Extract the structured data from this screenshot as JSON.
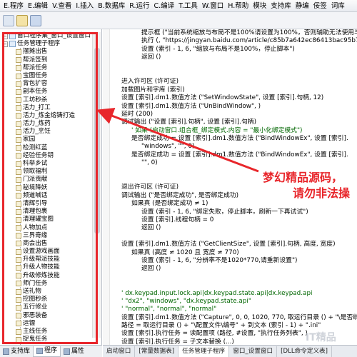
{
  "menubar": {
    "items": [
      "E.程序",
      "E.编辑",
      "V.查看",
      "I.插入",
      "B.数据库",
      "R.运行",
      "C.编译",
      "T.工具",
      "W.窗口",
      "H.帮助",
      "模块",
      "支持库",
      "静编",
      "佞签",
      "词库"
    ]
  },
  "tree": {
    "items": [
      {
        "label": "窗口程序集_窗口_设置窗口",
        "level": 0,
        "kind": "module"
      },
      {
        "label": "任务管理子程序",
        "level": 0,
        "kind": "module"
      },
      {
        "label": "摆摊出售",
        "level": 2,
        "kind": "sub"
      },
      {
        "label": "帮派签到",
        "level": 2,
        "kind": "sub"
      },
      {
        "label": "帮派任务",
        "level": 2,
        "kind": "sub"
      },
      {
        "label": "宝图任务",
        "level": 2,
        "kind": "sub"
      },
      {
        "label": "背包扩容",
        "level": 2,
        "kind": "sub"
      },
      {
        "label": "副本任务",
        "level": 2,
        "kind": "sub"
      },
      {
        "label": "工坊秒杀",
        "level": 2,
        "kind": "sub"
      },
      {
        "label": "活力_打工",
        "level": 2,
        "kind": "sub"
      },
      {
        "label": "活力_炼金熔铸打造",
        "level": 2,
        "kind": "sub"
      },
      {
        "label": "活力_炼药",
        "level": 2,
        "kind": "sub"
      },
      {
        "label": "活力_烹饪",
        "level": 2,
        "kind": "sub"
      },
      {
        "label": "家园",
        "level": 2,
        "kind": "sub"
      },
      {
        "label": "检测红蓝",
        "level": 2,
        "kind": "sub"
      },
      {
        "label": "经验任务钥",
        "level": 2,
        "kind": "sub"
      },
      {
        "label": "科举乡试",
        "level": 2,
        "kind": "sub"
      },
      {
        "label": "领取福利",
        "level": 2,
        "kind": "sub"
      },
      {
        "label": "门派贡献",
        "level": 2,
        "kind": "sub"
      },
      {
        "label": "秘境降妖",
        "level": 2,
        "kind": "sub"
      },
      {
        "label": "频道喊话",
        "level": 2,
        "kind": "sub"
      },
      {
        "label": "清辉引导",
        "level": 2,
        "kind": "sub"
      },
      {
        "label": "清理包裹",
        "level": 2,
        "kind": "sub"
      },
      {
        "label": "清理罐宝图",
        "level": 2,
        "kind": "sub"
      },
      {
        "label": "人物加点",
        "level": 2,
        "kind": "sub"
      },
      {
        "label": "三界奇缘",
        "level": 2,
        "kind": "sub"
      },
      {
        "label": "商会出售",
        "level": 2,
        "kind": "sub"
      },
      {
        "label": "设置游戏画面",
        "level": 2,
        "kind": "sub"
      },
      {
        "label": "升级帮派技能",
        "level": 2,
        "kind": "sub"
      },
      {
        "label": "升级人物技能",
        "level": 2,
        "kind": "sub"
      },
      {
        "label": "升级修炼技能",
        "level": 2,
        "kind": "sub"
      },
      {
        "label": "师门任务",
        "level": 2,
        "kind": "sub"
      },
      {
        "label": "送礼物",
        "level": 2,
        "kind": "sub"
      },
      {
        "label": "挖图秒杀",
        "level": 2,
        "kind": "sub"
      },
      {
        "label": "五行修业",
        "level": 2,
        "kind": "sub"
      },
      {
        "label": "邪恶装备",
        "level": 2,
        "kind": "sub"
      },
      {
        "label": "运镖",
        "level": 2,
        "kind": "sub"
      },
      {
        "label": "主线任务",
        "level": 2,
        "kind": "sub"
      },
      {
        "label": "捉鬼任务",
        "level": 2,
        "kind": "sub"
      }
    ]
  },
  "left_tabs": [
    "支持库",
    "程序",
    "属性"
  ],
  "code": {
    "lines": [
      {
        "ind": 3,
        "text": "提示框 (\"当前系统缩放与布局不是100%请设置为100%，否则辅助无法使用与设置教程\""
      },
      {
        "ind": 3,
        "text": "执行 (, \"https://jingyan.baidu.com/article/c85b7a642ec86413bac95b7.html\","
      },
      {
        "ind": 3,
        "text": "设置 (索引 - 1, 6, \"缩放与布局不是100%，停止脚本\")"
      },
      {
        "ind": 3,
        "text": "返回 ()"
      },
      {
        "ind": 0,
        "text": ""
      },
      {
        "ind": 0,
        "text": ""
      },
      {
        "ind": 1,
        "text": "进入许可区 (许可证)"
      },
      {
        "ind": 1,
        "text": "加载图片和字库 (索引)"
      },
      {
        "ind": 1,
        "text": "设置 [索引].dm1.数值方法 (\"SetWindowState\", 设置 [索引].句柄, 12)"
      },
      {
        "ind": 1,
        "text": "设置 [索引].dm1.数值方法 (\"UnBindWindow\", )"
      },
      {
        "ind": 1,
        "text": "延时 (200)"
      },
      {
        "ind": 1,
        "text": "调试输出 (\"设置 [索引].句柄\", 设置 [索引].句柄)"
      },
      {
        "ind": 2,
        "text": "' 如果 (启动窗口.组合框_绑定模式.内容 = \"最小化绑定模式\")"
      },
      {
        "ind": 2,
        "text": "是否绑定成功 = 设置 [索引].dm1.数值方法 (\"BindWindowEx\", 设置 [索引]."
      },
      {
        "ind": 3,
        "text": "\"windows\", \"\", 0)"
      },
      {
        "ind": 2,
        "text": "是否绑定成功 = 设置 [索引].dm1.数值方法 (\"BindWindowEx\", 设置 [索引]."
      },
      {
        "ind": 3,
        "text": "\"\", 0)"
      },
      {
        "ind": 0,
        "text": ""
      },
      {
        "ind": 0,
        "text": ""
      },
      {
        "ind": 1,
        "text": "退出许可区 (许可证)"
      },
      {
        "ind": 1,
        "text": "调试输出 (\"是否绑定成功\", 是否绑定成功)"
      },
      {
        "ind": 2,
        "text": "如果真 (是否绑定成功 ≠ 1)"
      },
      {
        "ind": 3,
        "text": "设置 (索引 - 1, 6, \"绑定失败，停止脚本，刷新一下再试试\")"
      },
      {
        "ind": 3,
        "text": "设置 [索引].线程句柄 = 0"
      },
      {
        "ind": 3,
        "text": "返回 ()"
      },
      {
        "ind": 0,
        "text": ""
      },
      {
        "ind": 1,
        "text": "设置 [索引].dm1.数值方法 (\"GetClientSize\", 设置 [索引].句柄, 高度, 宽度)"
      },
      {
        "ind": 2,
        "text": "如果真 (高度 ≠ 1020 且 宽度 ≠ 770)"
      },
      {
        "ind": 3,
        "text": "设置 (索引 - 1, 6, \"分辨率不是1020*770,请重新设置\")"
      },
      {
        "ind": 3,
        "text": "返回 ()"
      },
      {
        "ind": 0,
        "text": ""
      },
      {
        "ind": 0,
        "text": ""
      },
      {
        "ind": 1,
        "text": "' dx.keypad.input.lock.api|dx.keypad.state.api|dx.keypad.api"
      },
      {
        "ind": 1,
        "text": "' \"dx2\", \"windows\", \"dx.keypad.state.api\""
      },
      {
        "ind": 1,
        "text": "' \"normal\", \"normal\", \"normal\""
      },
      {
        "ind": 1,
        "text": "设置 [索引].dm1.数值方法 (\"Capture\", 0, 0, 1020, 770, 取运行目录 () + \"\\是否绑"
      },
      {
        "ind": 1,
        "text": "路径 = 取运行目录 () + \"\\配置文件\\编号\" + 到文本 (索引 - 1) + \".ini\""
      },
      {
        "ind": 1,
        "text": "设置 [索引].执行任务 = 读配置项 (路径, #设置, \"执行任务列表\", )"
      },
      {
        "ind": 1,
        "text": "设置 [索引].执行任务 = 子文本替换 (...)"
      }
    ]
  },
  "watermark": {
    "line1": "梦幻精品源码，",
    "line2": "请勿非法操"
  },
  "doc_tabs": [
    "启动窗口",
    "[常量数据表]",
    "任务管理子程序",
    "窗口_设置窗口",
    "[DLL命令定义表]"
  ],
  "faint_watermark": "IT精品"
}
